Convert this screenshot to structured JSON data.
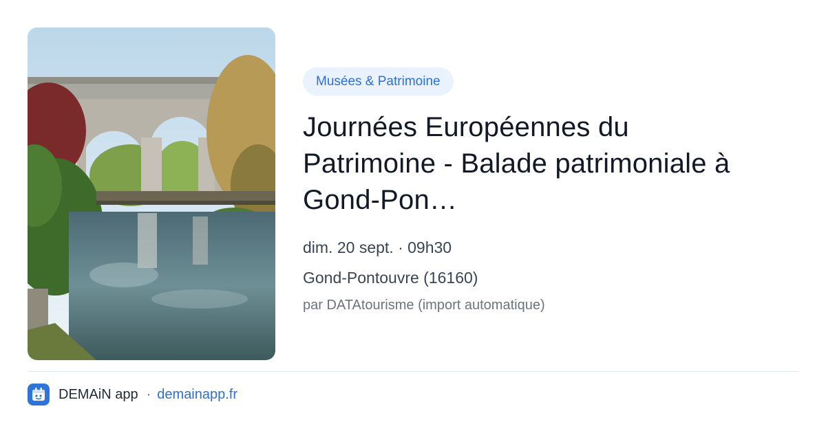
{
  "event": {
    "image_alt": "Viaduc de Gond-Pontouvre au-dessus de la rivière",
    "category": "Musées & Patrimoine",
    "title_lines": [
      "Journées Européennes du",
      "Patrimoine - Balade patrimoniale à",
      "Gond-Pon…"
    ],
    "datetime": "dim. 20 sept. · 09h30",
    "location": "Gond-Pontouvre (16160)",
    "source": "par DATAtourisme (import automatique)"
  },
  "footer": {
    "logo_icon": "demain-logo-icon",
    "app_name": "DEMAiN app",
    "separator": "·",
    "link_text": "demainapp.fr"
  },
  "colors": {
    "accent": "#2f6fd0",
    "badge_background": "#eaf2fd",
    "logo_background": "#2f74d8"
  }
}
